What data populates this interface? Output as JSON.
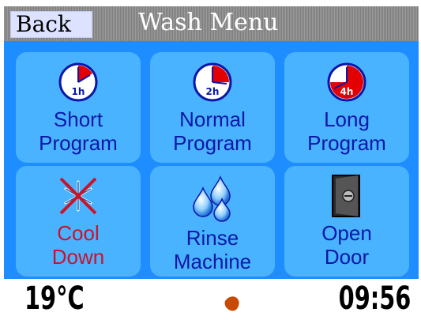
{
  "header": {
    "back_label": "Back",
    "title": "Wash Menu"
  },
  "tiles": [
    {
      "line1": "Short",
      "line2": "Program",
      "icon": "clock-1h-icon",
      "badge": "1h"
    },
    {
      "line1": "Normal",
      "line2": "Program",
      "icon": "clock-2h-icon",
      "badge": "2h"
    },
    {
      "line1": "Long",
      "line2": "Program",
      "icon": "clock-4h-icon",
      "badge": "4h"
    },
    {
      "line1": "Cool",
      "line2": "Down",
      "icon": "snowflake-crossed-icon"
    },
    {
      "line1": "Rinse",
      "line2": "Machine",
      "icon": "water-drops-icon"
    },
    {
      "line1": "Open",
      "line2": "Door",
      "icon": "door-icon"
    }
  ],
  "status": {
    "temperature": "19°C",
    "time": "09:56"
  },
  "colors": {
    "screen": "#1e8dff",
    "tile": "#4ab3ff",
    "label": "#0b17a8",
    "disabled_label": "#c8142a",
    "status_dot": "#c84a00"
  }
}
